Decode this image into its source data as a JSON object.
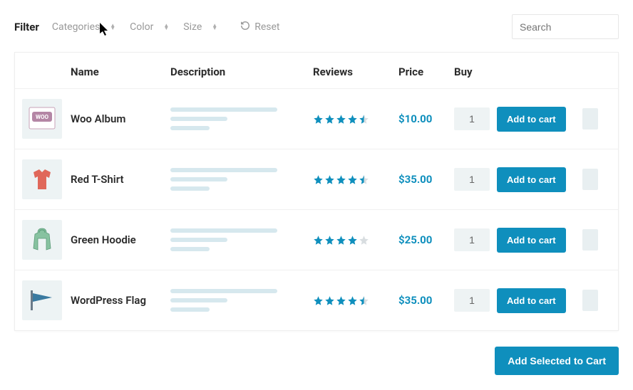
{
  "filter": {
    "label": "Filter",
    "categories_label": "Categories",
    "color_label": "Color",
    "size_label": "Size",
    "reset_label": "Reset",
    "search_placeholder": "Search"
  },
  "columns": {
    "name": "Name",
    "description": "Description",
    "reviews": "Reviews",
    "price": "Price",
    "buy": "Buy"
  },
  "products": [
    {
      "name": "Woo Album",
      "price": "$10.00",
      "rating": 4.5,
      "qty": "1"
    },
    {
      "name": "Red T-Shirt",
      "price": "$35.00",
      "rating": 4.5,
      "qty": "1"
    },
    {
      "name": "Green Hoodie",
      "price": "$25.00",
      "rating": 4.0,
      "qty": "1"
    },
    {
      "name": "WordPress Flag",
      "price": "$35.00",
      "rating": 4.5,
      "qty": "1"
    }
  ],
  "buttons": {
    "add_to_cart": "Add to cart",
    "add_selected": "Add Selected to Cart"
  },
  "colors": {
    "accent": "#0f8fbd"
  }
}
